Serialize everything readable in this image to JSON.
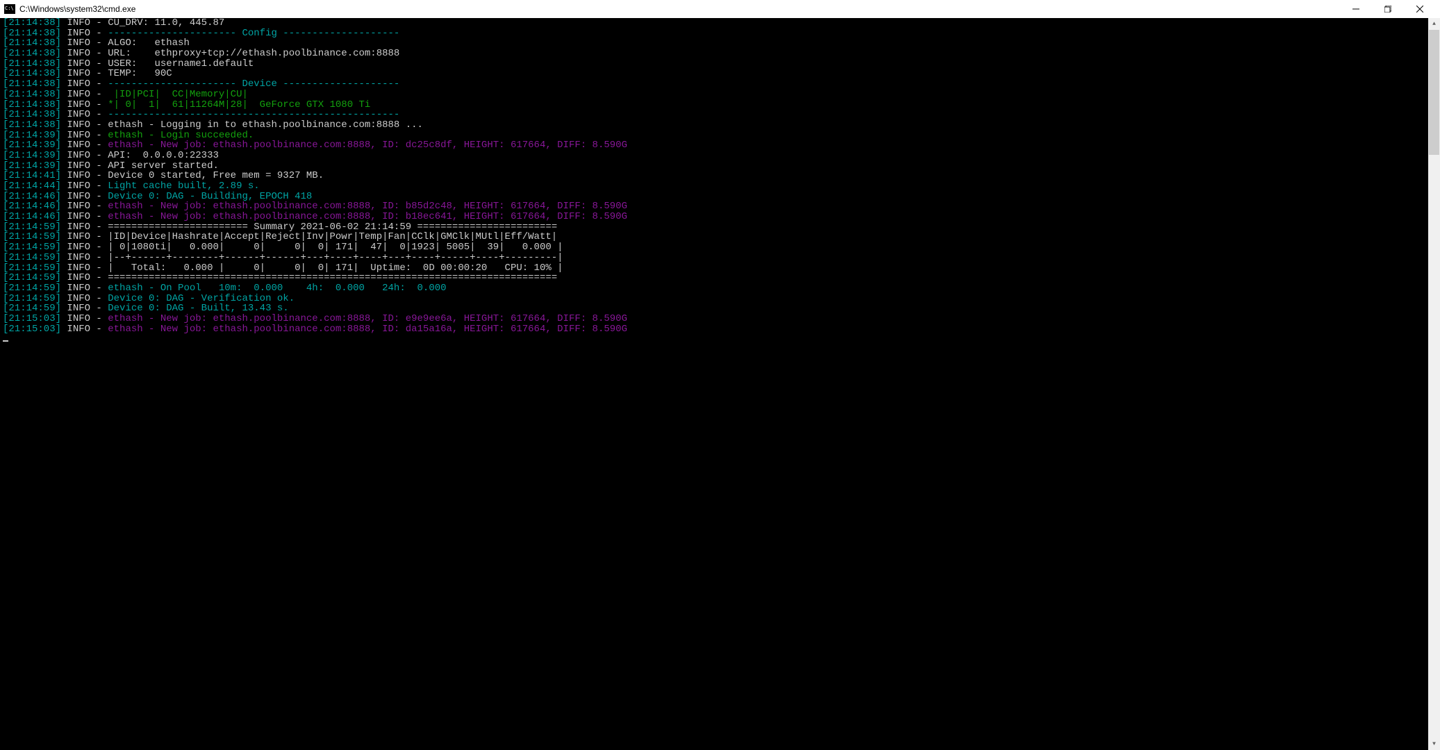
{
  "window": {
    "title": "C:\\Windows\\system32\\cmd.exe"
  },
  "lines": [
    {
      "ts": "[21:14:38]",
      "lv": "INFO -",
      "segs": [
        {
          "c": "white",
          "t": " CU_DRV: 11.0, 445.87"
        }
      ]
    },
    {
      "ts": "[21:14:38]",
      "lv": "INFO -",
      "segs": [
        {
          "c": "teal",
          "t": " ---------------------- Config --------------------"
        }
      ]
    },
    {
      "ts": "[21:14:38]",
      "lv": "INFO -",
      "segs": [
        {
          "c": "white",
          "t": " ALGO:   ethash"
        }
      ]
    },
    {
      "ts": "[21:14:38]",
      "lv": "INFO -",
      "segs": [
        {
          "c": "white",
          "t": " URL:    ethproxy+tcp://ethash.poolbinance.com:8888"
        }
      ]
    },
    {
      "ts": "[21:14:38]",
      "lv": "INFO -",
      "segs": [
        {
          "c": "white",
          "t": " USER:   username1.default"
        }
      ]
    },
    {
      "ts": "[21:14:38]",
      "lv": "INFO -",
      "segs": [
        {
          "c": "white",
          "t": " TEMP:   90C"
        }
      ]
    },
    {
      "ts": "[21:14:38]",
      "lv": "INFO -",
      "segs": [
        {
          "c": "teal",
          "t": " ---------------------- Device --------------------"
        }
      ]
    },
    {
      "ts": "[21:14:38]",
      "lv": "INFO -",
      "segs": [
        {
          "c": "green",
          "t": "  |ID|PCI|  CC|Memory|CU|"
        }
      ]
    },
    {
      "ts": "[21:14:38]",
      "lv": "INFO -",
      "segs": [
        {
          "c": "green",
          "t": " *| 0|  1|  61|11264M|28|  GeForce GTX 1080 Ti"
        }
      ]
    },
    {
      "ts": "[21:14:38]",
      "lv": "INFO -",
      "segs": [
        {
          "c": "teal",
          "t": " --------------------------------------------------"
        }
      ]
    },
    {
      "ts": "[21:14:38]",
      "lv": "INFO -",
      "segs": [
        {
          "c": "white",
          "t": " ethash - Logging in to ethash.poolbinance.com:8888 ..."
        }
      ]
    },
    {
      "ts": "[21:14:39]",
      "lv": "INFO -",
      "segs": [
        {
          "c": "green",
          "t": " ethash - Login succeeded."
        }
      ]
    },
    {
      "ts": "[21:14:39]",
      "lv": "INFO -",
      "segs": [
        {
          "c": "magenta",
          "t": " ethash - New job: ethash.poolbinance.com:8888, ID: dc25c8df, HEIGHT: 617664, DIFF: 8.590G"
        }
      ]
    },
    {
      "ts": "[21:14:39]",
      "lv": "INFO -",
      "segs": [
        {
          "c": "white",
          "t": " API:  0.0.0.0:22333"
        }
      ]
    },
    {
      "ts": "[21:14:39]",
      "lv": "INFO -",
      "segs": [
        {
          "c": "white",
          "t": " API server started."
        }
      ]
    },
    {
      "ts": "[21:14:41]",
      "lv": "INFO -",
      "segs": [
        {
          "c": "white",
          "t": " Device 0 started, Free mem = 9327 MB."
        }
      ]
    },
    {
      "ts": "[21:14:44]",
      "lv": "INFO -",
      "segs": [
        {
          "c": "teal",
          "t": " Light cache built, 2.89 s."
        }
      ]
    },
    {
      "ts": "[21:14:46]",
      "lv": "INFO -",
      "segs": [
        {
          "c": "teal",
          "t": " Device 0: DAG - Building, EPOCH 418"
        }
      ]
    },
    {
      "ts": "[21:14:46]",
      "lv": "INFO -",
      "segs": [
        {
          "c": "magenta",
          "t": " ethash - New job: ethash.poolbinance.com:8888, ID: b85d2c48, HEIGHT: 617664, DIFF: 8.590G"
        }
      ]
    },
    {
      "ts": "[21:14:46]",
      "lv": "INFO -",
      "segs": [
        {
          "c": "magenta",
          "t": " ethash - New job: ethash.poolbinance.com:8888, ID: b18ec641, HEIGHT: 617664, DIFF: 8.590G"
        }
      ]
    },
    {
      "ts": "[21:14:59]",
      "lv": "INFO -",
      "segs": [
        {
          "c": "white",
          "t": " ======================== Summary 2021-06-02 21:14:59 ========================"
        }
      ]
    },
    {
      "ts": "[21:14:59]",
      "lv": "INFO -",
      "segs": [
        {
          "c": "white",
          "t": " |ID|Device|Hashrate|Accept|Reject|Inv|Powr|Temp|Fan|CClk|GMClk|MUtl|Eff/Watt|"
        }
      ]
    },
    {
      "ts": "[21:14:59]",
      "lv": "INFO -",
      "segs": [
        {
          "c": "white",
          "t": " | 0|1080ti|   0.000|     0|     0|  0| 171|  47|  0|1923| 5005|  39|   0.000 |"
        }
      ]
    },
    {
      "ts": "[21:14:59]",
      "lv": "INFO -",
      "segs": [
        {
          "c": "white",
          "t": " |--+------+--------+------+------+---+----+----+---+----+-----+----+---------|"
        }
      ]
    },
    {
      "ts": "[21:14:59]",
      "lv": "INFO -",
      "segs": [
        {
          "c": "white",
          "t": " |   Total:   0.000 |     0|     0|  0| 171|  Uptime:  0D 00:00:20   CPU: 10% |"
        }
      ]
    },
    {
      "ts": "[21:14:59]",
      "lv": "INFO -",
      "segs": [
        {
          "c": "white",
          "t": " ============================================================================="
        }
      ]
    },
    {
      "ts": "[21:14:59]",
      "lv": "INFO -",
      "segs": [
        {
          "c": "teal",
          "t": " ethash - On Pool   10m:  0.000    4h:  0.000   24h:  0.000"
        }
      ]
    },
    {
      "ts": "[21:14:59]",
      "lv": "INFO -",
      "segs": [
        {
          "c": "teal",
          "t": " Device 0: DAG - Verification ok."
        }
      ]
    },
    {
      "ts": "[21:14:59]",
      "lv": "INFO -",
      "segs": [
        {
          "c": "teal",
          "t": " Device 0: DAG - Built, 13.43 s."
        }
      ]
    },
    {
      "ts": "[21:15:03]",
      "lv": "INFO -",
      "segs": [
        {
          "c": "magenta",
          "t": " ethash - New job: ethash.poolbinance.com:8888, ID: e9e9ee6a, HEIGHT: 617664, DIFF: 8.590G"
        }
      ]
    },
    {
      "ts": "[21:15:03]",
      "lv": "INFO -",
      "segs": [
        {
          "c": "magenta",
          "t": " ethash - New job: ethash.poolbinance.com:8888, ID: da15a16a, HEIGHT: 617664, DIFF: 8.590G"
        }
      ]
    }
  ]
}
